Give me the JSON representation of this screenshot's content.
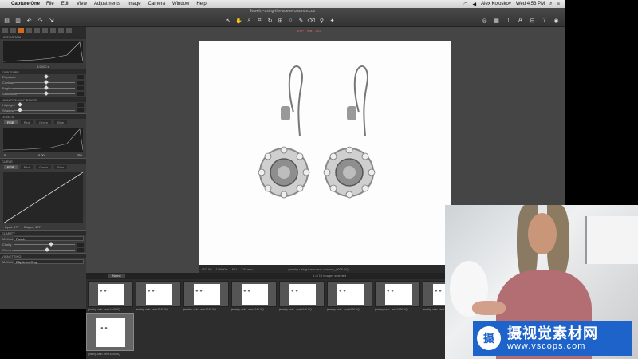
{
  "menubar": {
    "app_name": "Capture One",
    "items": [
      "File",
      "Edit",
      "View",
      "Adjustments",
      "Image",
      "Camera",
      "Window",
      "Help"
    ],
    "user": "Alex Koloskov",
    "clock": "Wed 4:53 PM"
  },
  "toolbar": {
    "document_title": "Jewelry-using-the-scene-cosmos.cos"
  },
  "left_panel": {
    "sections": {
      "histogram": "HISTOGRAM",
      "exposure": "EXPOSURE",
      "hdr": "HIGH DYNAMIC RANGE",
      "levels": "LEVELS",
      "curve": "CURVE",
      "clarity": "CLARITY",
      "vignetting": "VIGNETTING"
    },
    "histogram_readout": "1/2000 s",
    "exposure_labels": [
      "Exposure",
      "Contrast",
      "Brightness",
      "Saturation"
    ],
    "hdr_labels": [
      "Highlight",
      "Shadow"
    ],
    "levels_tabs": [
      "RGB",
      "Red",
      "Green",
      "Blue"
    ],
    "levels_low": "0",
    "levels_mid": "0.00",
    "levels_high": "255",
    "curve_tabs": [
      "RGB",
      "Red",
      "Green",
      "Blue"
    ],
    "curve_input": "Input: 177",
    "curve_output": "Output: 177",
    "clarity_method_label": "Method",
    "clarity_method": "Punch",
    "clarity_labels": [
      "Clarity",
      "Structure"
    ],
    "vignetting_label": "Method",
    "vignetting_method": "Elliptic on Crop"
  },
  "viewer": {
    "chips": [
      "EXP",
      "WB",
      "ISO"
    ],
    "caption_iso": "ISO 50",
    "caption_shutter": "1/2000 s",
    "caption_aperture": "f/11",
    "caption_focal": "120 mm",
    "caption_filename": "jewelry-using-the-scene-cosmos_0005.IIQ"
  },
  "browser": {
    "tab_label": "Name",
    "count": "1 of 10 images selected",
    "thumbs": [
      "jewelry-usin...ene1440.IIQ",
      "jewelry-usin...ene1440.IIQ",
      "jewelry-usin...ene1440.IIQ",
      "jewelry-usin...ene1440.IIQ",
      "jewelry-usin...ene1440.IIQ",
      "jewelry-usin...ene1440.IIQ",
      "jewelry-usin...ene1440.IIQ",
      "jewelry-usin...ene1440.IIQ"
    ],
    "selected_thumb": "jewelry-usin...ene1440.IIQ"
  },
  "watermark": {
    "text_cn": "摄视觉素材网",
    "url": "www.vscops.com"
  },
  "icons": {
    "apple": "apple-icon",
    "wifi": "wifi-icon",
    "volume": "volume-icon",
    "search": "search-icon"
  },
  "colors": {
    "accent": "#d36a1d",
    "watermark_blue": "#1e63c9"
  }
}
